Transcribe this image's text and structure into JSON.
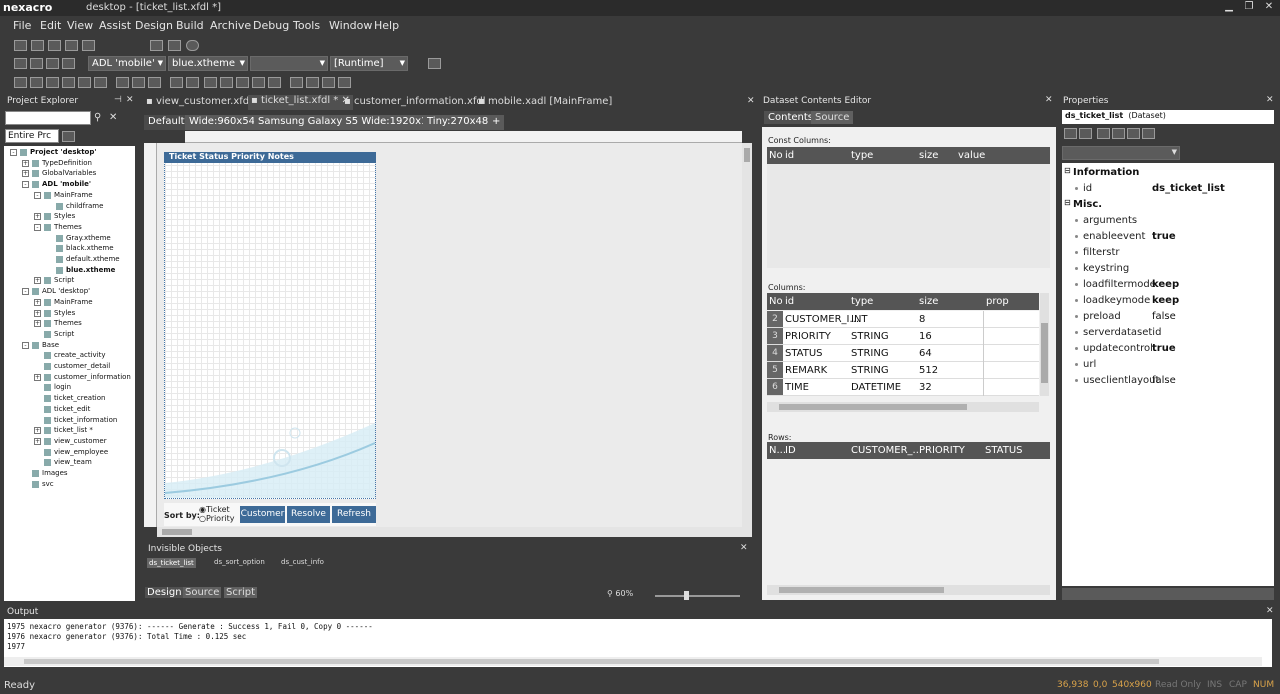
{
  "app": {
    "logo": "nexacro",
    "title": "desktop - [ticket_list.xfdl *]"
  },
  "menu": [
    "File",
    "Edit",
    "View",
    "Assist",
    "Design",
    "Build",
    "Archive",
    "Debug",
    "Tools",
    "Window",
    "Help"
  ],
  "toolbar": {
    "adl": "ADL 'mobile'",
    "theme": "blue.xtheme",
    "runtime": "[Runtime]"
  },
  "project_explorer": {
    "title": "Project Explorer",
    "filter": "Entire Prc",
    "tree": [
      {
        "label": "Project 'desktop'",
        "bold": true,
        "exp": "-"
      },
      {
        "label": "TypeDefinition",
        "exp": "+"
      },
      {
        "label": "GlobalVariables",
        "exp": "+"
      },
      {
        "label": "ADL 'mobile'",
        "bold": true,
        "exp": "-"
      },
      {
        "label": "MainFrame",
        "exp": "-"
      },
      {
        "label": "childframe"
      },
      {
        "label": "Styles",
        "exp": "+"
      },
      {
        "label": "Themes",
        "exp": "-"
      },
      {
        "label": "Gray.xtheme"
      },
      {
        "label": "black.xtheme"
      },
      {
        "label": "default.xtheme"
      },
      {
        "label": "blue.xtheme",
        "bold": true
      },
      {
        "label": "Script",
        "exp": "+"
      },
      {
        "label": "ADL 'desktop'",
        "exp": "-"
      },
      {
        "label": "MainFrame",
        "exp": "+"
      },
      {
        "label": "Styles",
        "exp": "+"
      },
      {
        "label": "Themes",
        "exp": "+"
      },
      {
        "label": "Script"
      },
      {
        "label": "Base",
        "exp": "-"
      },
      {
        "label": "create_activity"
      },
      {
        "label": "customer_detail"
      },
      {
        "label": "customer_information",
        "exp": "+"
      },
      {
        "label": "login"
      },
      {
        "label": "ticket_creation"
      },
      {
        "label": "ticket_edit"
      },
      {
        "label": "ticket_information"
      },
      {
        "label": "ticket_list *",
        "exp": "+"
      },
      {
        "label": "view_customer",
        "exp": "+"
      },
      {
        "label": "view_employee"
      },
      {
        "label": "view_team"
      },
      {
        "label": "Images"
      },
      {
        "label": "svc"
      }
    ]
  },
  "editor_tabs": [
    "view_customer.xfdl",
    "ticket_list.xfdl *",
    "customer_information.xfdl",
    "mobile.xadl [MainFrame]"
  ],
  "screen_tabs": [
    "Default",
    "Wide:960x540",
    "Samsung Galaxy S5 Wide:1920x1080",
    "Tiny:270x480",
    "+"
  ],
  "form": {
    "header": "Ticket Status  Priority Notes",
    "sort_label": "Sort by:",
    "radio1": "Ticket",
    "radio2": "Priority",
    "btn_customer": "Customer",
    "btn_resolve": "Resolve",
    "btn_refresh": "Refresh"
  },
  "invisible_objects": {
    "title": "Invisible Objects",
    "items": [
      "ds_ticket_list",
      "ds_sort_option",
      "ds_cust_info"
    ]
  },
  "design_tabs": [
    "Design",
    "Source",
    "Script"
  ],
  "zoom": "60%",
  "dataset_editor": {
    "title": "Dataset Contents Editor",
    "tabs": [
      "Contents",
      "Source"
    ],
    "const_label": "Const Columns:",
    "const_headers": [
      "No",
      "id",
      "type",
      "size",
      "value"
    ],
    "columns_label": "Columns:",
    "col_headers": [
      "No",
      "id",
      "type",
      "size",
      "prop"
    ],
    "columns": [
      [
        "2",
        "CUSTOMER_I...",
        "INT",
        "8"
      ],
      [
        "3",
        "PRIORITY",
        "STRING",
        "16"
      ],
      [
        "4",
        "STATUS",
        "STRING",
        "64"
      ],
      [
        "5",
        "REMARK",
        "STRING",
        "512"
      ],
      [
        "6",
        "TIME",
        "DATETIME",
        "32"
      ]
    ],
    "rows_label": "Rows:",
    "row_headers": [
      "N...",
      "ID",
      "CUSTOMER_...",
      "PRIORITY",
      "STATUS"
    ]
  },
  "properties": {
    "title": "Properties",
    "object": "ds_ticket_list",
    "object_type": "(Dataset)",
    "groups": [
      {
        "name": "Information",
        "props": [
          [
            "id",
            "ds_ticket_list"
          ]
        ]
      },
      {
        "name": "Misc.",
        "props": [
          [
            "arguments",
            ""
          ],
          [
            "enableevent",
            "true"
          ],
          [
            "filterstr",
            ""
          ],
          [
            "keystring",
            ""
          ],
          [
            "loadfiltermode",
            "keep"
          ],
          [
            "loadkeymode",
            "keep"
          ],
          [
            "preload",
            "false"
          ],
          [
            "serverdatasetid",
            ""
          ],
          [
            "updatecontrol",
            "true"
          ],
          [
            "url",
            ""
          ],
          [
            "useclientlayout",
            "false"
          ]
        ]
      }
    ]
  },
  "output": {
    "title": "Output",
    "lines": [
      "1975 nexacro generator (9376): ------ Generate : Success 1, Fail 0, Copy 0 ------",
      "1976 nexacro generator (9376): Total Time : 0.125 sec",
      "1977"
    ]
  },
  "status": {
    "left": "Ready",
    "coords": "36,938",
    "offset": "0,0",
    "size": "540x960",
    "readonly": "Read Only",
    "ins": "INS",
    "cap": "CAP",
    "num": "NUM"
  }
}
